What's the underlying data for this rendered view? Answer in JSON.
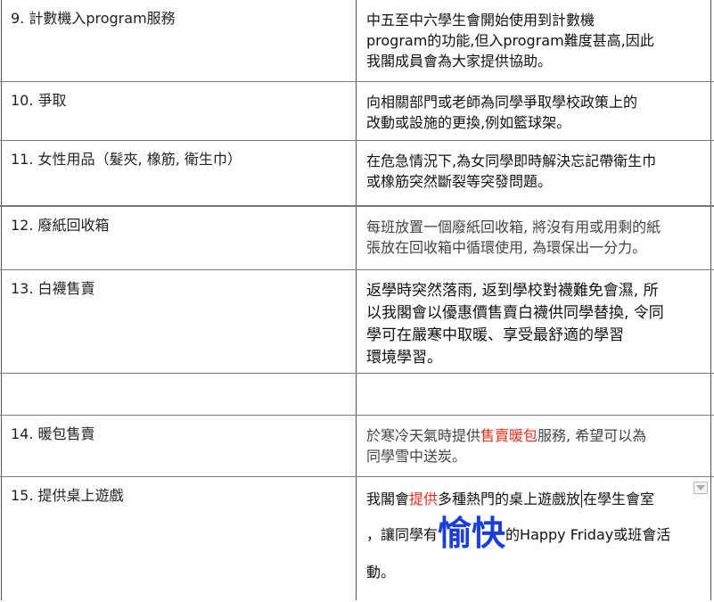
{
  "rows": [
    {
      "item": "9. 計數機入program服務",
      "desc_lines": [
        "中五至中六學生會開始使用到計數機",
        "program的功能,但入program難度甚高,因此",
        "我閣成員會為大家提供協助。"
      ]
    },
    {
      "item": "10. 爭取",
      "desc_lines": [
        "向相關部門或老師為同學爭取學校政策上的",
        "改動或設施的更換,例如籃球架。"
      ]
    },
    {
      "item": "11. 女性用品（髮夾, 橡筋, 衛生巾）",
      "desc_lines": [
        "在危急情況下,為女同學即時解決忘記帶衛生巾",
        "或橡筋突然斷裂等突發問題。"
      ]
    },
    {
      "item": "12. 廢紙回收箱",
      "desc_lines": [
        "每班放置一個廢紙回收箱, 將沒有用或用剩的紙",
        "張放在回收箱中循環使用, 為環保出一分力。"
      ]
    },
    {
      "item": "13. 白襪售賣",
      "desc_lines": [
        "返學時突然落雨, 返到學校對襪難免會濕, 所",
        "以我閣會以優惠價售賣白襪供同學替換, 令同",
        "學可在嚴寒中取暖、享受最舒適的學習",
        "環境學習。"
      ]
    },
    {
      "item": "",
      "desc_lines": []
    },
    {
      "item": "14. 暖包售賣",
      "desc_parts_line1": [
        "於寒冷天氣時提供",
        "售賣暖包",
        "服務, 希望可以為"
      ],
      "desc_lines": [
        "同學雪中送炭。"
      ]
    },
    {
      "item": "15. 提供桌上遊戲",
      "desc_line1_parts": [
        "我閣會",
        "提供",
        "多種熱門的桌上遊戲放",
        "在學生會室"
      ],
      "desc_line2_parts": [
        "，讓同學有",
        "愉快",
        "的Happy Friday或班會活"
      ],
      "desc_line3": "動。"
    }
  ],
  "colors": {
    "highlight_red": "#e0301e",
    "highlight_blue": "#1b3fd6"
  },
  "icons": {
    "cell_menu": "dropdown-arrow-icon"
  }
}
